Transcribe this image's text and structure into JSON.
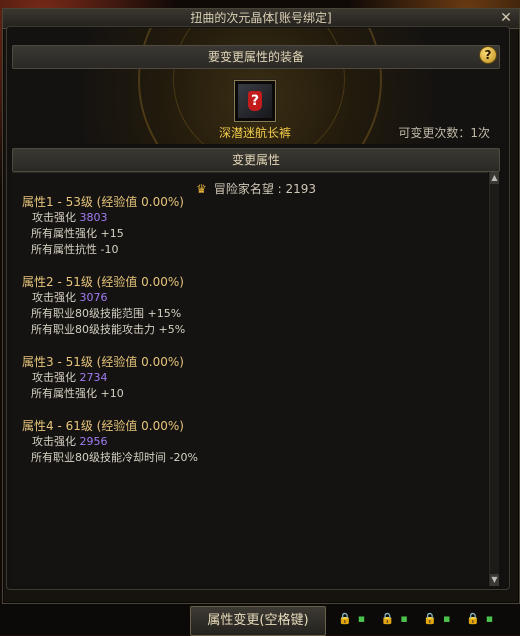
{
  "window": {
    "title": "扭曲的次元晶体[账号绑定]",
    "close_glyph": "✕"
  },
  "equipment_section": {
    "header": "要变更属性的装备",
    "help_glyph": "?",
    "item_name": "深潜迷航长裤",
    "item_icon_glyph": "?",
    "change_count": "可变更次数：1次"
  },
  "attribute_section": {
    "header": "变更属性",
    "reputation_label": "冒险家名望",
    "reputation_value": ": 2193",
    "attributes": [
      {
        "head": "属性1 - 53级 (经验值 0.00%)",
        "attack_label": "攻击强化",
        "attack_value": "3803",
        "lines": [
          "所有属性强化 +15",
          "所有属性抗性 -10"
        ]
      },
      {
        "head": "属性2 - 51级 (经验值 0.00%)",
        "attack_label": "攻击强化",
        "attack_value": "3076",
        "lines": [
          "所有职业80级技能范围 +15%",
          "所有职业80级技能攻击力 +5%"
        ]
      },
      {
        "head": "属性3 - 51级 (经验值 0.00%)",
        "attack_label": "攻击强化",
        "attack_value": "2734",
        "lines": [
          "所有属性强化 +10"
        ]
      },
      {
        "head": "属性4 - 61级 (经验值 0.00%)",
        "attack_label": "攻击强化",
        "attack_value": "2956",
        "lines": [
          "所有职业80级技能冷却时间 -20%"
        ]
      }
    ]
  },
  "action_button": "属性变更(空格键)",
  "scroll": {
    "up": "▲",
    "down": "▼"
  },
  "colors": {
    "gold": "#f1c94a",
    "purple": "#a07cf0",
    "header_text": "#e2d6b8"
  }
}
